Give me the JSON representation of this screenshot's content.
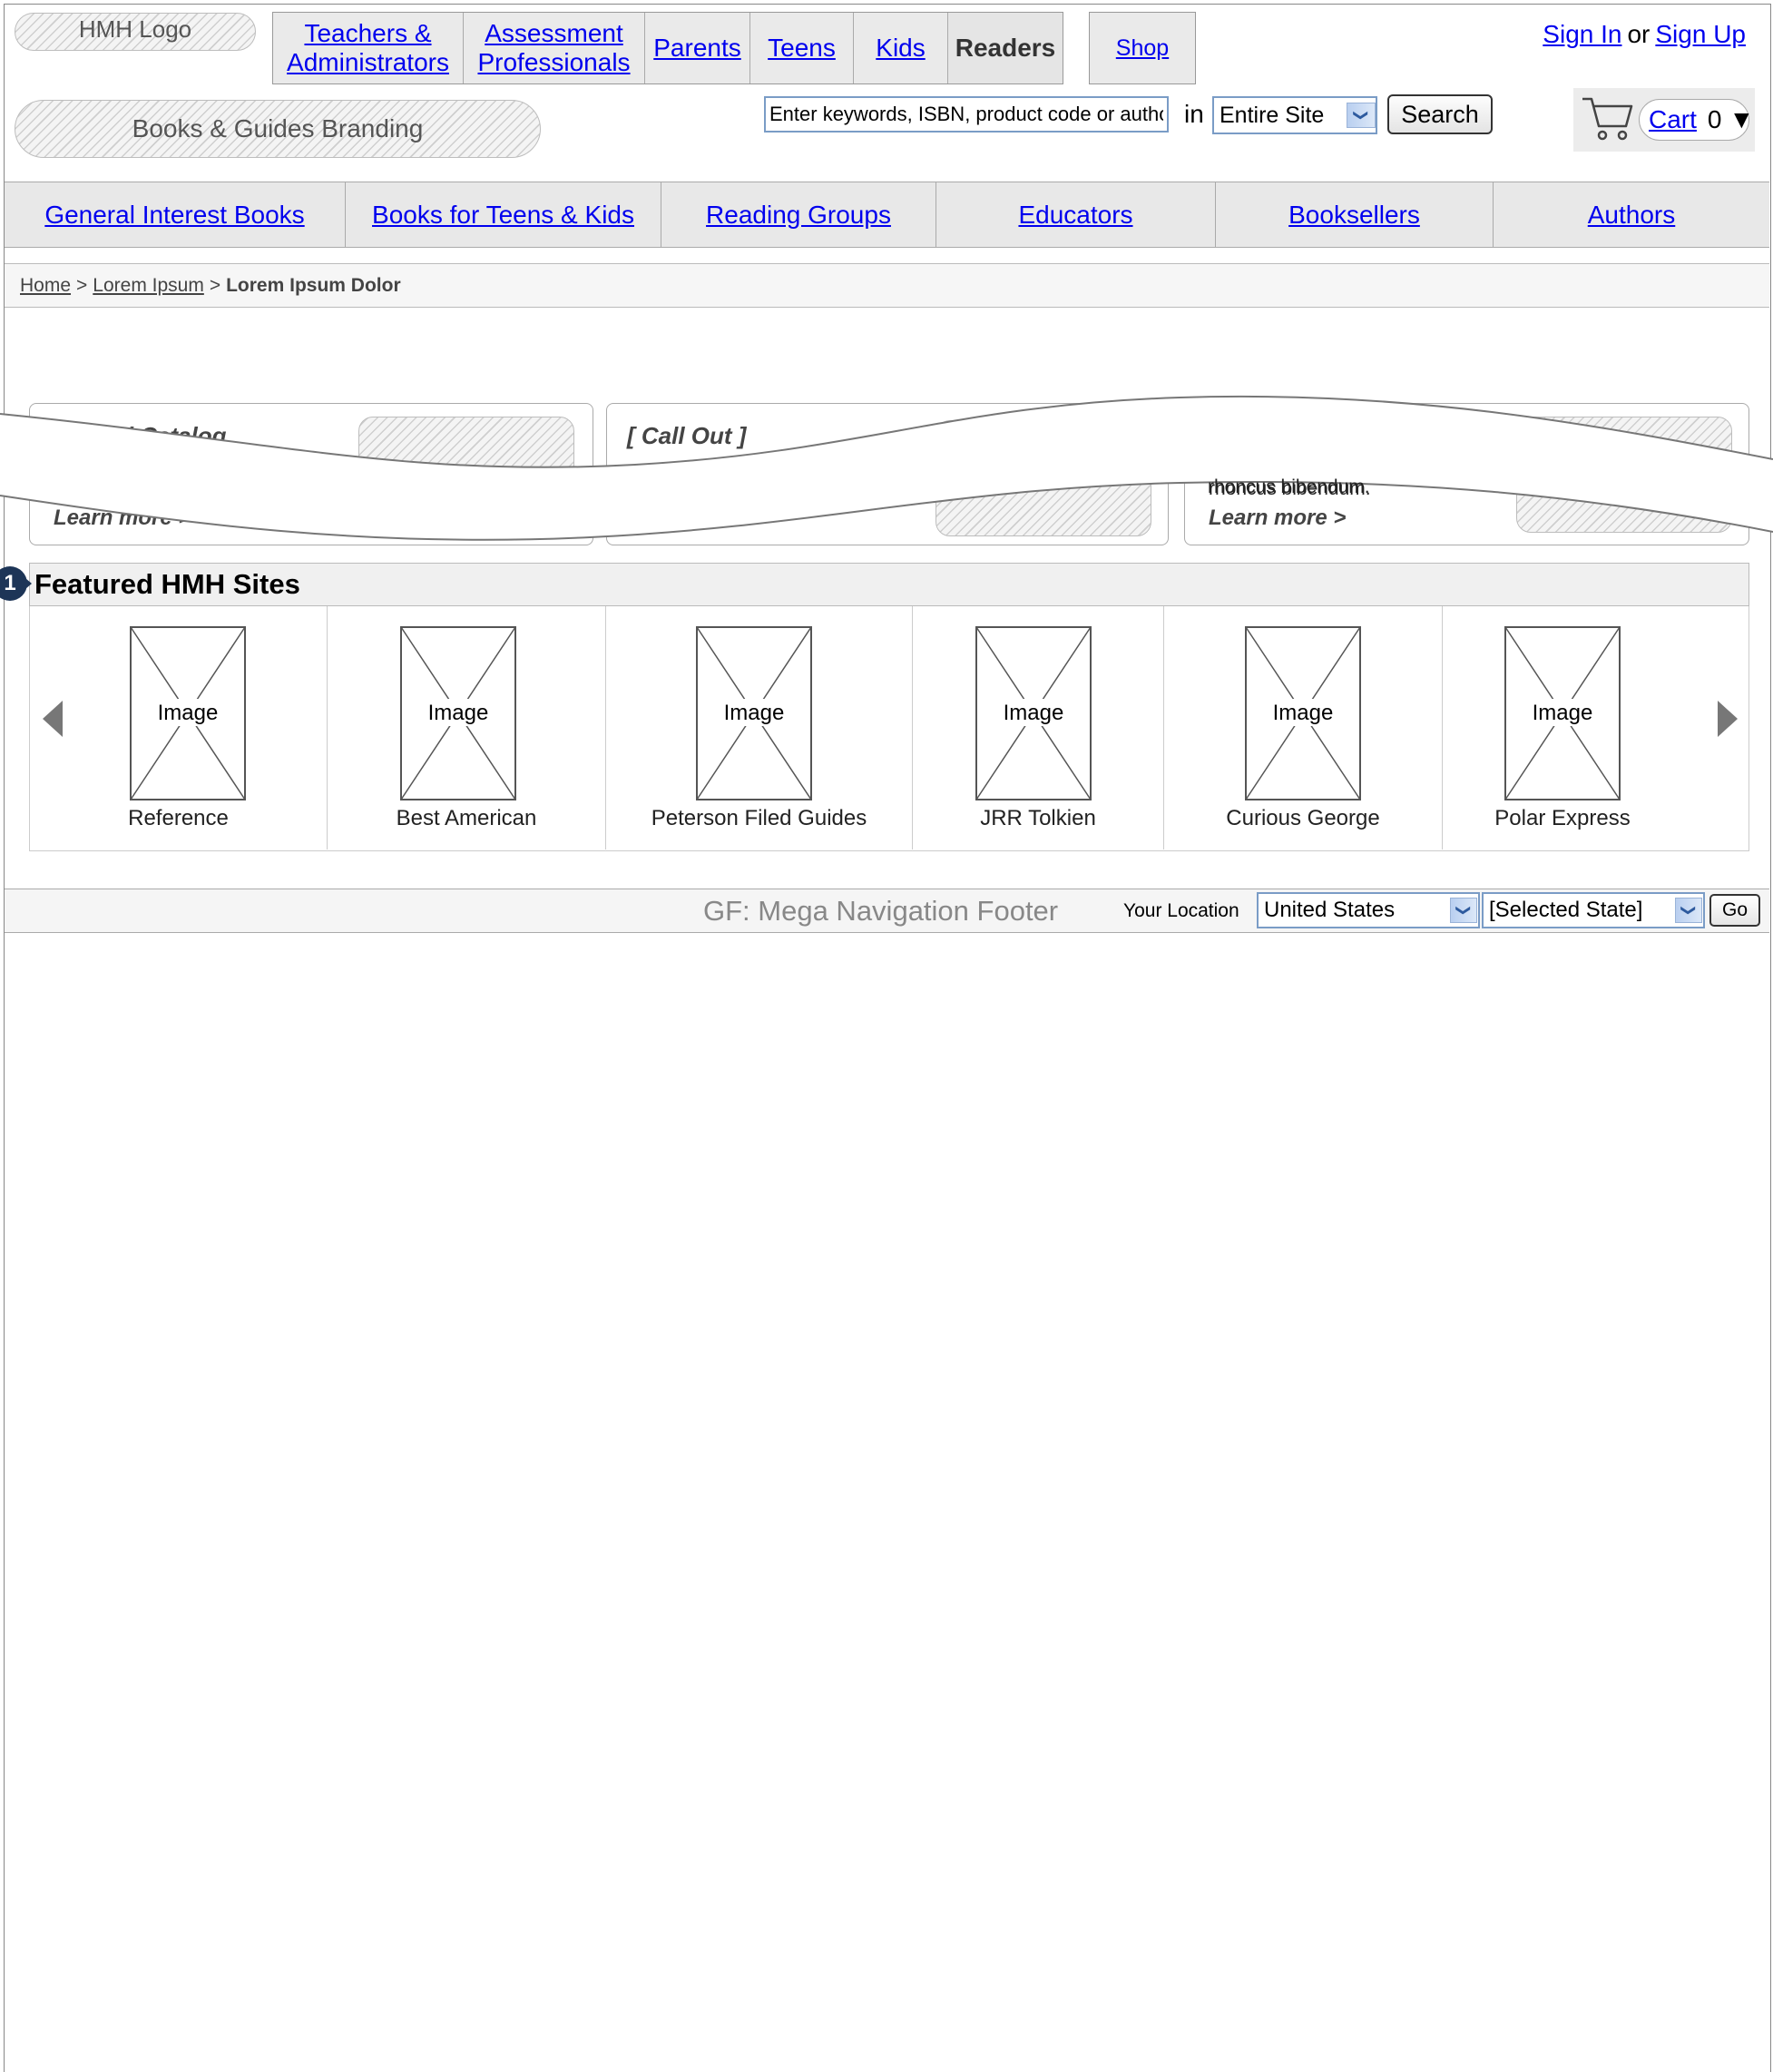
{
  "header": {
    "logo": "HMH Logo",
    "branding": "Books & Guides Branding",
    "audience_tabs": [
      {
        "label": "Teachers & Administrators",
        "active": false
      },
      {
        "label": "Assessment Professionals",
        "active": false
      },
      {
        "label": "Parents",
        "active": false
      },
      {
        "label": "Teens",
        "active": false
      },
      {
        "label": "Kids",
        "active": false
      },
      {
        "label": "Readers",
        "active": true
      }
    ],
    "shop": "Shop",
    "sign_in": "Sign In",
    "or": "or",
    "sign_up": "Sign Up"
  },
  "search": {
    "placeholder": "Enter keywords, ISBN, product code or author",
    "in_label": "in",
    "scope_selected": "Entire Site",
    "button": "Search"
  },
  "cart": {
    "label": "Cart",
    "count": "0",
    "toggle": "▼"
  },
  "main_nav": [
    "General Interest Books",
    "Books for Teens & Kids",
    "Reading Groups",
    "Educators",
    "Booksellers",
    "Authors"
  ],
  "breadcrumb": {
    "items": [
      "Home",
      "Lorem Ipsum"
    ],
    "separator": ">",
    "current": "Lorem Ipsum Dolor"
  },
  "callouts": [
    {
      "title": "Virtual Catalog",
      "body": "",
      "link": "Learn more >",
      "visual": "Visual Element"
    },
    {
      "title": "[ Call Out ]",
      "body": "",
      "link": "",
      "visual": "Visual Element"
    },
    {
      "title": "",
      "body": "rhoncus bibendum.",
      "link": "Learn more >",
      "visual": ""
    }
  ],
  "featured": {
    "marker": "1",
    "title": "Featured HMH Sites",
    "image_placeholder": "Image",
    "sites": [
      "Reference",
      "Best American",
      "Peterson Filed Guides",
      "JRR Tolkien",
      "Curious George",
      "Polar Express"
    ]
  },
  "footer": {
    "title": "GF: Mega Navigation Footer",
    "location_label": "Your Location",
    "country_selected": "United States",
    "state_selected": "[Selected State]",
    "go_button": "Go"
  },
  "colors": {
    "link": "#0000ee",
    "marker": "#1d3557",
    "select_border": "#7a9cc6"
  }
}
